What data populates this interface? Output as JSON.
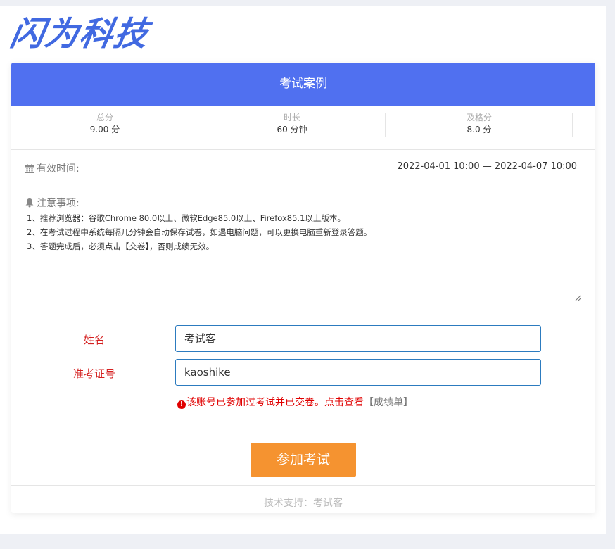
{
  "brand": {
    "logo_text": "闪为科技",
    "color": "#4169e1"
  },
  "card": {
    "title": "考试案例",
    "header_color": "#5070f0"
  },
  "stats": [
    {
      "label": "总分",
      "value": "9.00 分"
    },
    {
      "label": "时长",
      "value": "60 分钟"
    },
    {
      "label": "及格分",
      "value": "8.0 分"
    }
  ],
  "valid": {
    "icon": "calendar-icon",
    "label": "有效时间:",
    "time": "2022-04-01 10:00 — 2022-04-07 10:00"
  },
  "notes": {
    "icon": "bell-icon",
    "title": "注意事项:",
    "lines": [
      "1、推荐浏览器：谷歌Chrome 80.0以上、微软Edge85.0以上、Firefox85.1以上版本。",
      "2、在考试过程中系统每隔几分钟会自动保存试卷，如遇电脑问题，可以更换电脑重新登录答题。",
      "3、答题完成后，必须点击【交卷】，否则成绩无效。"
    ]
  },
  "form": {
    "name_label": "姓名",
    "name_value": "考试客",
    "id_label": "准考证号",
    "id_value": "kaoshike",
    "label_color": "#d42020"
  },
  "warning": {
    "icon": "exclamation-circle-icon",
    "text": "该账号已参加过考试并已交卷。点击查看",
    "link": "【成绩单】",
    "color": "#e00000"
  },
  "join_button": {
    "label": "参加考试",
    "color": "#f59330"
  },
  "footer": {
    "text": "技术支持：考试客"
  }
}
